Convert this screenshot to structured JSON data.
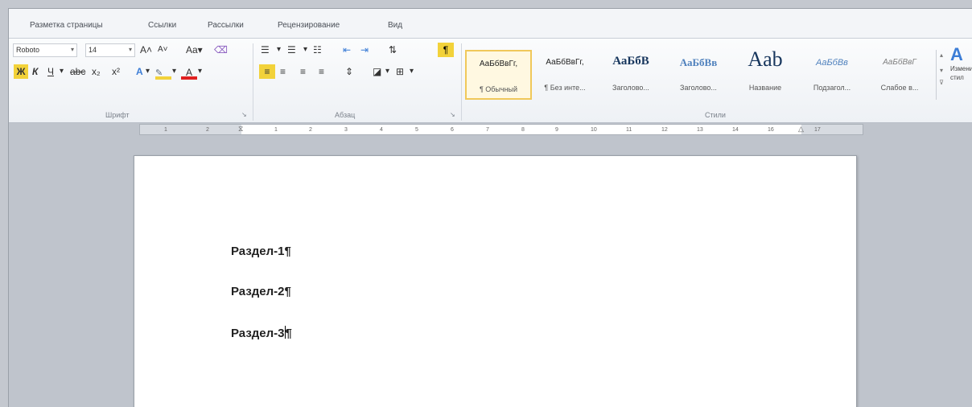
{
  "tabs": [
    "Разметка страницы",
    "Ссылки",
    "Рассылки",
    "Рецензирование",
    "Вид"
  ],
  "font": {
    "name": "Roboto",
    "size": "14",
    "grow": "A˄",
    "shrink": "A˅",
    "case": "Aa▾",
    "clear": "🧹"
  },
  "format": [
    "Ж",
    "К",
    "Ч",
    "abc",
    "x₂",
    "x²"
  ],
  "groups": {
    "font": "Шрифт",
    "paragraph": "Абзац",
    "styles": "Стили"
  },
  "styles": [
    {
      "preview": "АаБбВвГг,",
      "name": "¶ Обычный"
    },
    {
      "preview": "АаБбВвГг,",
      "name": "¶ Без инте..."
    },
    {
      "preview": "АаБбВ",
      "name": "Заголово..."
    },
    {
      "preview": "АаБбВв",
      "name": "Заголово..."
    },
    {
      "preview": "Aab",
      "name": "Название"
    },
    {
      "preview": "АаБбВв",
      "name": "Подзагол..."
    },
    {
      "preview": "АаБбВвГ",
      "name": "Слабое в..."
    }
  ],
  "change_styles": "Измени стил",
  "ruler_ticks": [
    "1",
    "2",
    "1",
    "1",
    "2",
    "3",
    "4",
    "5",
    "6",
    "7",
    "8",
    "9",
    "10",
    "11",
    "12",
    "13",
    "14",
    "15",
    "16",
    "17"
  ],
  "doc": {
    "lines": [
      "Раздел-1¶",
      "Раздел-2¶"
    ],
    "line3_before": "Раздел-3",
    "line3_after": "¶"
  },
  "colors": {
    "ribbon": "#f3f5f8",
    "selected_style": "#f0c85a",
    "highlight": "#f2d23a",
    "font_color": "#e02020"
  }
}
